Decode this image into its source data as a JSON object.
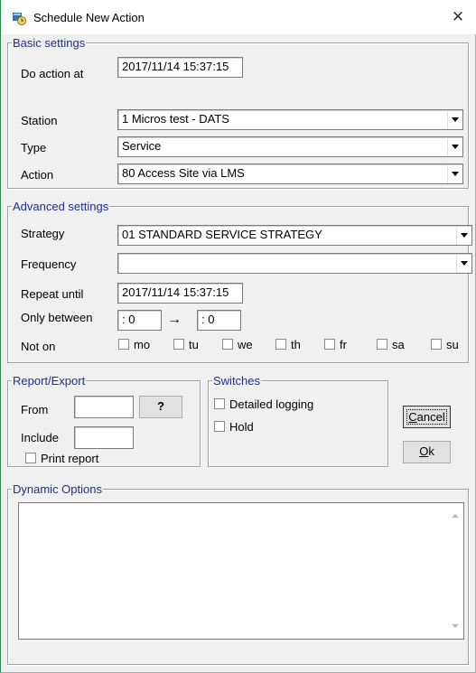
{
  "window": {
    "title": "Schedule New Action"
  },
  "basic": {
    "legend": "Basic settings",
    "do_action_label": "Do action at",
    "do_action_value": "2017/11/14  15:37:15",
    "station_label": "Station",
    "station_value": "  1 Micros test - DATS",
    "type_label": "Type",
    "type_value": "Service",
    "action_label": "Action",
    "action_value": "80  Access Site via LMS"
  },
  "advanced": {
    "legend": "Advanced settings",
    "strategy_label": "Strategy",
    "strategy_value": "01  STANDARD SERVICE STRATEGY",
    "frequency_label": "Frequency",
    "frequency_value": "",
    "repeat_label": "Repeat until",
    "repeat_value": "2017/11/14  15:37:15",
    "between_label": "Only between",
    "between_from": " : 0",
    "between_arrow": "→",
    "between_to": " : 0",
    "noton_label": "Not on",
    "days": [
      "mo",
      "tu",
      "we",
      "th",
      "fr",
      "sa",
      "su"
    ]
  },
  "report": {
    "legend": "Report/Export",
    "from_label": "From",
    "from_value": "",
    "browse_label": "?",
    "include_label": "Include",
    "include_value": "",
    "print_label": "Print report"
  },
  "switches": {
    "legend": "Switches",
    "detailed_label": "Detailed logging",
    "hold_label": "Hold"
  },
  "buttons": {
    "cancel_accel": "C",
    "cancel_rest": "ancel",
    "ok_accel": "O",
    "ok_rest": "k"
  },
  "dynamic": {
    "legend": "Dynamic Options"
  },
  "icons": {
    "app": "scheduler-icon",
    "close": "close-icon",
    "dropdown": "chevron-down-icon"
  }
}
